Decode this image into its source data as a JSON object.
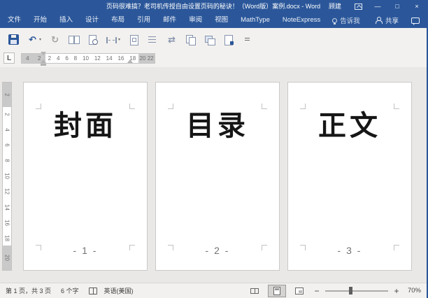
{
  "colors": {
    "accent": "#2b579a",
    "chrome_bg": "#f3f1ef",
    "doc_bg": "#e9e8e6",
    "page_bg": "#ffffff",
    "ruler_margin": "#c9c9c9",
    "page_number": "#737373",
    "status_text": "#3c3c3c"
  },
  "title_bar": {
    "title": "页码很难搞？老司机传授自由设置页码的秘诀！（Word版）案例.docx - Word",
    "user": "顾建",
    "minimize": "—",
    "maximize": "□",
    "close": "×"
  },
  "ribbon": {
    "tabs": [
      "文件",
      "开始",
      "插入",
      "设计",
      "布局",
      "引用",
      "邮件",
      "审阅",
      "视图",
      "MathType",
      "NoteExpress"
    ],
    "tell_me": "告诉我",
    "share": "共享"
  },
  "toolbar": {
    "icons": [
      {
        "name": "save-icon",
        "kind": "save"
      },
      {
        "name": "undo-icon",
        "kind": "glyph",
        "glyph": "↶",
        "color": "#2b579a",
        "dropdown": true
      },
      {
        "name": "redo-icon",
        "kind": "glyph",
        "glyph": "↻",
        "color": "#a3a3a3"
      },
      {
        "name": "two-page-view-icon",
        "kind": "twopage"
      },
      {
        "name": "print-preview-icon",
        "kind": "preview"
      },
      {
        "name": "page-break-icon",
        "kind": "break",
        "dropdown": true
      },
      {
        "name": "page-border-icon",
        "kind": "pagedoc"
      },
      {
        "name": "list-format-icon",
        "kind": "listarrow"
      },
      {
        "name": "swap-arrows-icon",
        "kind": "glyph",
        "glyph": "⇄",
        "color": "#8593ad"
      },
      {
        "name": "copy-page-icon",
        "kind": "copypage"
      },
      {
        "name": "switch-windows-icon",
        "kind": "windows"
      },
      {
        "name": "shrink-page-icon",
        "kind": "shrink"
      },
      {
        "name": "toolbar-overflow-icon",
        "kind": "overflow"
      }
    ]
  },
  "ruler": {
    "tab_selector": "L",
    "h_left_margin_labels": [
      "4",
      "2"
    ],
    "h_labels": [
      "2",
      "4",
      "6",
      "8",
      "10",
      "12",
      "14",
      "16",
      "18"
    ],
    "h_right_margin_labels": [
      "20",
      "22"
    ],
    "v_top_margin_labels": [
      "2"
    ],
    "v_labels": [
      "2",
      "4",
      "6",
      "8",
      "10",
      "12",
      "14",
      "16",
      "18"
    ],
    "v_bottom_margin_labels": [
      "20"
    ]
  },
  "pages": [
    {
      "title": "封面",
      "number": "- 1 -"
    },
    {
      "title": "目录",
      "number": "- 2 -"
    },
    {
      "title": "正文",
      "number": "- 3 -"
    }
  ],
  "status_bar": {
    "page_info": "第 1 页，共 3 页",
    "word_count": "6 个字",
    "language": "英语(美国)",
    "zoom_out": "−",
    "zoom_in": "+",
    "zoom_level": "70%"
  }
}
